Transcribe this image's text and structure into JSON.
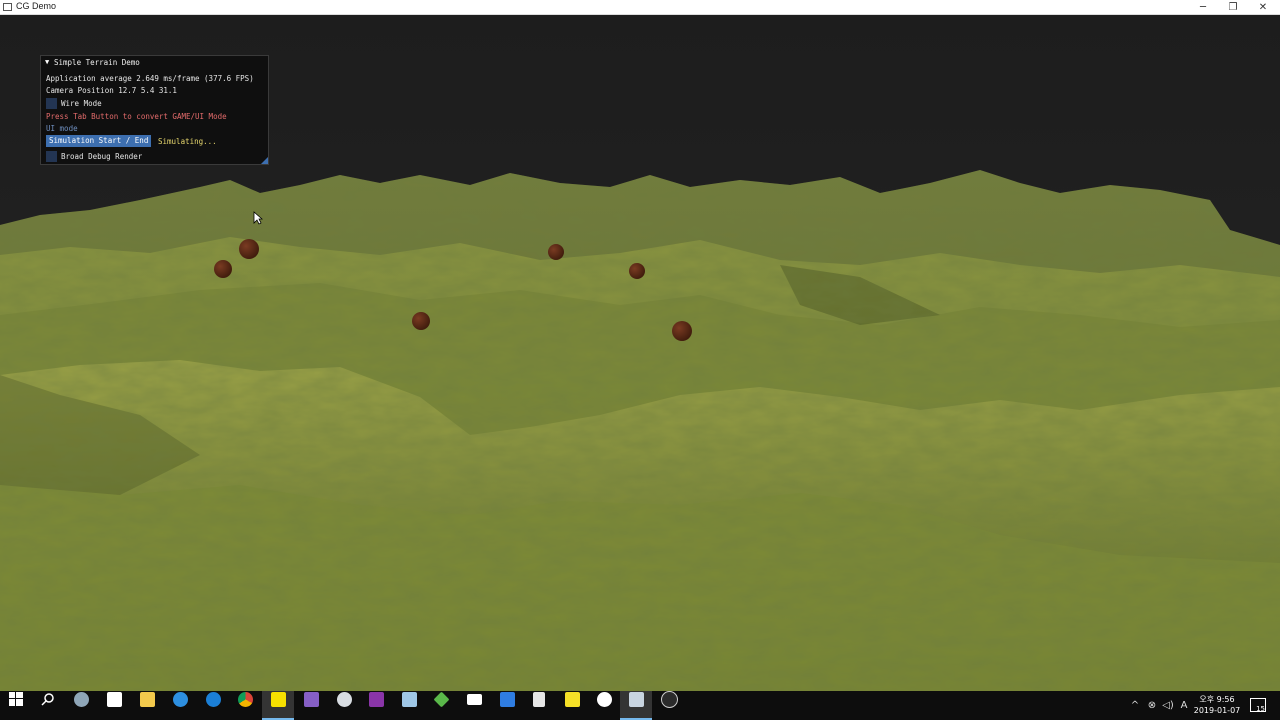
{
  "window": {
    "title": "CG Demo",
    "minimize_glyph": "─",
    "maximize_glyph": "❐",
    "close_glyph": "✕"
  },
  "panel": {
    "title": "Simple Terrain Demo",
    "collapse_glyph": "▼",
    "fps_text": "Application average 2.649 ms/frame (377.6 FPS)",
    "camera_text": "Camera Position 12.7 5.4 31.1",
    "wire_mode_label": "Wire Mode",
    "wire_mode_checked": false,
    "hint_text": "Press Tab Button to convert GAME/UI Mode",
    "mode_text": "UI mode",
    "sim_button_label": "Simulation Start / End",
    "sim_status": "Simulating...",
    "debug_label": "Broad Debug Render",
    "debug_checked": false
  },
  "scene": {
    "terrain_color": "#6b7a2e",
    "sphere_color": "#5a2a16",
    "sky_color": "#1e1e1e"
  },
  "taskbar": {
    "icons": [
      "windows-start-icon",
      "search-icon",
      "cortana-icon",
      "store-icon",
      "file-explorer-icon",
      "ie-icon",
      "edge-icon",
      "chrome-icon",
      "kakaotalk-icon",
      "visual-studio-icon",
      "cloud-app-icon",
      "onenote-icon",
      "notes-app-icon",
      "gem-app-icon",
      "mail-icon",
      "dropbox-icon",
      "calculator-icon",
      "sticky-notes-icon",
      "github-icon",
      "cg-demo-icon",
      "obs-icon"
    ],
    "tray_chevron": "^",
    "ime_label": "A",
    "time": "오후 9:56",
    "date": "2019-01-07",
    "notification_count": "15"
  }
}
